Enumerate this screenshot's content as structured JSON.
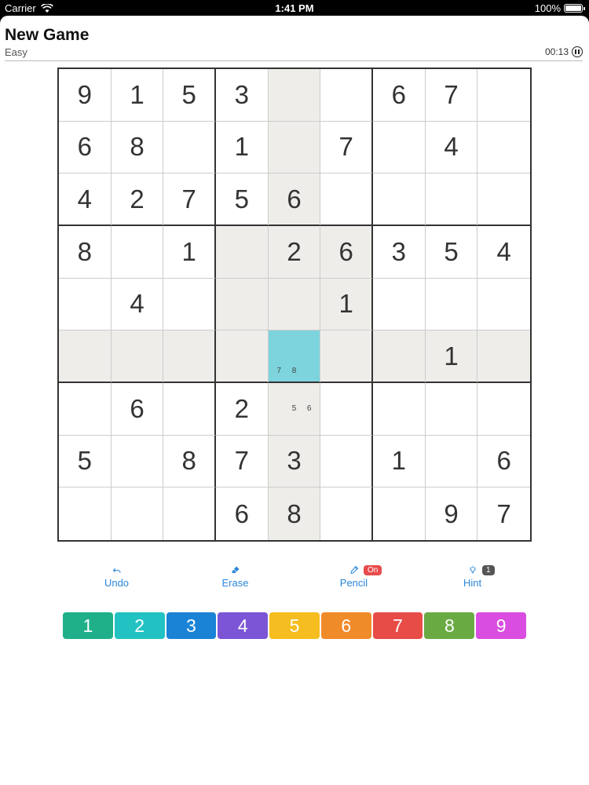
{
  "status_bar": {
    "carrier": "Carrier",
    "time": "1:41 PM",
    "battery": "100%"
  },
  "header": {
    "title": "New Game",
    "difficulty": "Easy",
    "timer": "00:13"
  },
  "board": {
    "rows": [
      [
        "9",
        "1",
        "5",
        "3",
        "",
        "",
        "6",
        "7",
        ""
      ],
      [
        "6",
        "8",
        "",
        "1",
        "",
        "7",
        "",
        "4",
        ""
      ],
      [
        "4",
        "2",
        "7",
        "5",
        "6",
        "",
        "",
        "",
        ""
      ],
      [
        "8",
        "",
        "1",
        "",
        "2",
        "6",
        "3",
        "5",
        "4"
      ],
      [
        "",
        "4",
        "",
        "",
        "",
        "1",
        "",
        "",
        ""
      ],
      [
        "",
        "",
        "",
        "",
        "",
        "",
        "",
        "1",
        ""
      ],
      [
        "",
        "6",
        "",
        "2",
        "",
        "",
        "",
        "",
        ""
      ],
      [
        "5",
        "",
        "8",
        "7",
        "3",
        "",
        "1",
        "",
        "6"
      ],
      [
        "",
        "",
        "",
        "6",
        "8",
        "",
        "",
        "9",
        "7"
      ]
    ],
    "notes": {
      "5,4": [
        "7",
        "8"
      ],
      "6,4": [
        "5",
        "6"
      ]
    },
    "selected": "5,4"
  },
  "toolbar": {
    "undo": "Undo",
    "erase": "Erase",
    "pencil": "Pencil",
    "pencil_badge": "On",
    "hint": "Hint",
    "hint_badge": "1"
  },
  "numpad": [
    {
      "label": "1",
      "color": "#1fb08a"
    },
    {
      "label": "2",
      "color": "#22c2c3"
    },
    {
      "label": "3",
      "color": "#1a83d6"
    },
    {
      "label": "4",
      "color": "#7b55d6"
    },
    {
      "label": "5",
      "color": "#f5bd1f"
    },
    {
      "label": "6",
      "color": "#f08b2a"
    },
    {
      "label": "7",
      "color": "#e84c47"
    },
    {
      "label": "8",
      "color": "#6aaa43"
    },
    {
      "label": "9",
      "color": "#d94de0"
    }
  ]
}
